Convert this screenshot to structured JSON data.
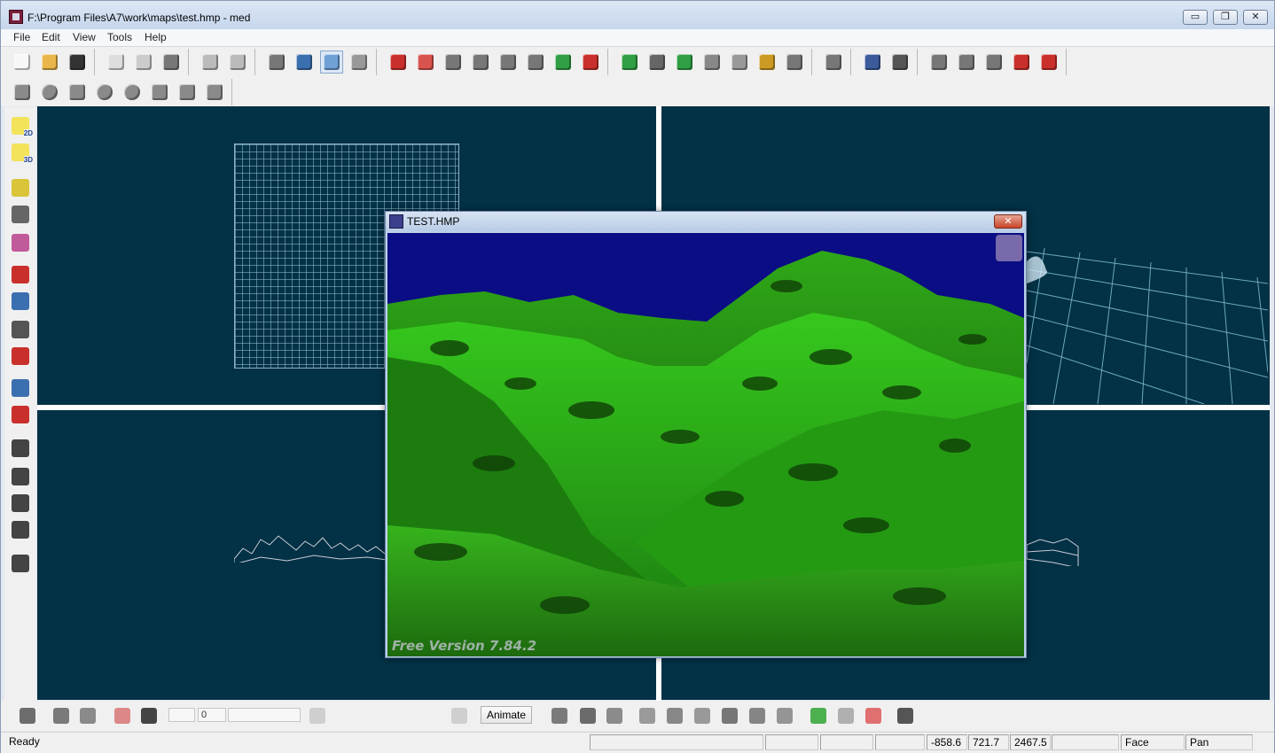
{
  "window": {
    "title": "F:\\Program Files\\A7\\work\\maps\\test.hmp - med",
    "minimize_label": "▭",
    "restore_label": "❐",
    "close_label": "✕"
  },
  "menu": {
    "items": [
      "File",
      "Edit",
      "View",
      "Tools",
      "Help"
    ]
  },
  "toolbar": {
    "row1_icons": [
      "new-file-icon",
      "open-folder-icon",
      "save-icon",
      "copy-icon",
      "paste-icon",
      "delete-icon",
      "undo-icon",
      "redo-icon",
      "object-icon",
      "object-group-icon",
      "object-select-icon",
      "path-icon",
      "entity-icon",
      "light-icon",
      "position-icon",
      "block-icon",
      "block-2-icon",
      "block-3-icon",
      "run-map-icon",
      "build-red-icon",
      "build-green-icon",
      "rotate-icon",
      "move-up-icon",
      "scale-icon",
      "texture-icon",
      "script-icon",
      "add-icon",
      "scissors-icon",
      "link-icon",
      "cut-icon",
      "cube-icon",
      "cube-2-icon",
      "cube-3-icon",
      "cube-red-icon",
      "magnet-icon"
    ],
    "row2_icons": [
      "cube-shape-icon",
      "sphere-shape-icon",
      "cylinder-shape-icon",
      "torus-shape-icon",
      "torus2-shape-icon",
      "cone-shape-icon",
      "pyramid-shape-icon",
      "diamond-shape-icon"
    ]
  },
  "left_toolbar": {
    "icons": [
      "view-2d-icon",
      "view-3d-icon",
      "camera-icon",
      "camera-move-icon",
      "rotate-view-icon",
      "object-red-icon",
      "object-blue-icon",
      "eye-icon",
      "eye-red-icon",
      "group-icon",
      "group-red-icon",
      "layout-1-icon",
      "layout-2-icon",
      "layout-3-icon",
      "layout-4-icon",
      "layout-5-icon"
    ],
    "badge_2d": "2D",
    "badge_3d": "3D"
  },
  "render_window": {
    "title": "TEST.HMP",
    "close_label": "✕",
    "watermark": "Free Version 7.84.2"
  },
  "bottom_toolbar": {
    "frame_value": "0",
    "animate_label": "Animate"
  },
  "status": {
    "text": "Ready",
    "x": "-858.6",
    "y": "721.7",
    "z": "2467.5",
    "mode": "Face",
    "action": "Pan"
  },
  "colors": {
    "viewport_bg": "#033145",
    "sky": "#0b0d84",
    "terrain": "#2fb51c"
  }
}
